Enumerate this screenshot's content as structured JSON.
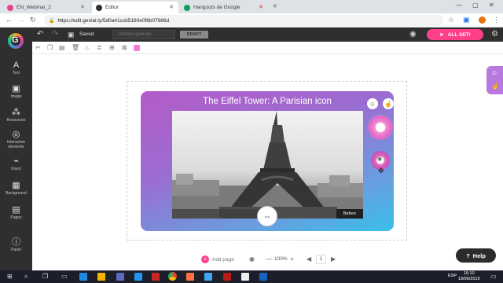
{
  "browser": {
    "tabs": [
      {
        "label": "EN_Webinar_2",
        "color": "#e84393"
      },
      {
        "label": "Editor",
        "color": "#2f2f2f"
      },
      {
        "label": "Hangouts de Google",
        "color": "#0f9d58"
      }
    ],
    "url": "https://edit.genial.ly/5d0a41ccb5160e0f6b07666d",
    "icons": [
      "back-arrow",
      "forward-arrow",
      "reload",
      "star",
      "extension",
      "profile",
      "menu"
    ]
  },
  "appbar": {
    "saved_label": "Saved",
    "title_placeholder": "Untitled genially",
    "draft_label": "DRAFT",
    "allset_label": "ALL SET!",
    "accent": "#ff3f8a"
  },
  "sidebar": {
    "items": [
      {
        "label": "Text",
        "icon": "A"
      },
      {
        "label": "Image",
        "icon": "▣"
      },
      {
        "label": "Resources",
        "icon": "⁂"
      },
      {
        "label": "Interactive elements",
        "icon": "◎"
      },
      {
        "label": "Insert",
        "icon": "⌁"
      },
      {
        "label": "Background",
        "icon": "▦"
      },
      {
        "label": "Pages",
        "icon": "▤"
      },
      {
        "label": "Panel",
        "icon": "ⓘ"
      }
    ]
  },
  "slide": {
    "title": "The Eiffel Tower: A Parisian icon",
    "before_label": "Before",
    "gradient_start": "#b45bc8",
    "gradient_end": "#38c0e8"
  },
  "bottom": {
    "add_page_label": "Add page",
    "zoom": "100%",
    "page_number": "1",
    "help_label": "Help"
  },
  "taskbar": {
    "lang": "ESP",
    "time": "16:10",
    "date": "19/06/2019"
  }
}
